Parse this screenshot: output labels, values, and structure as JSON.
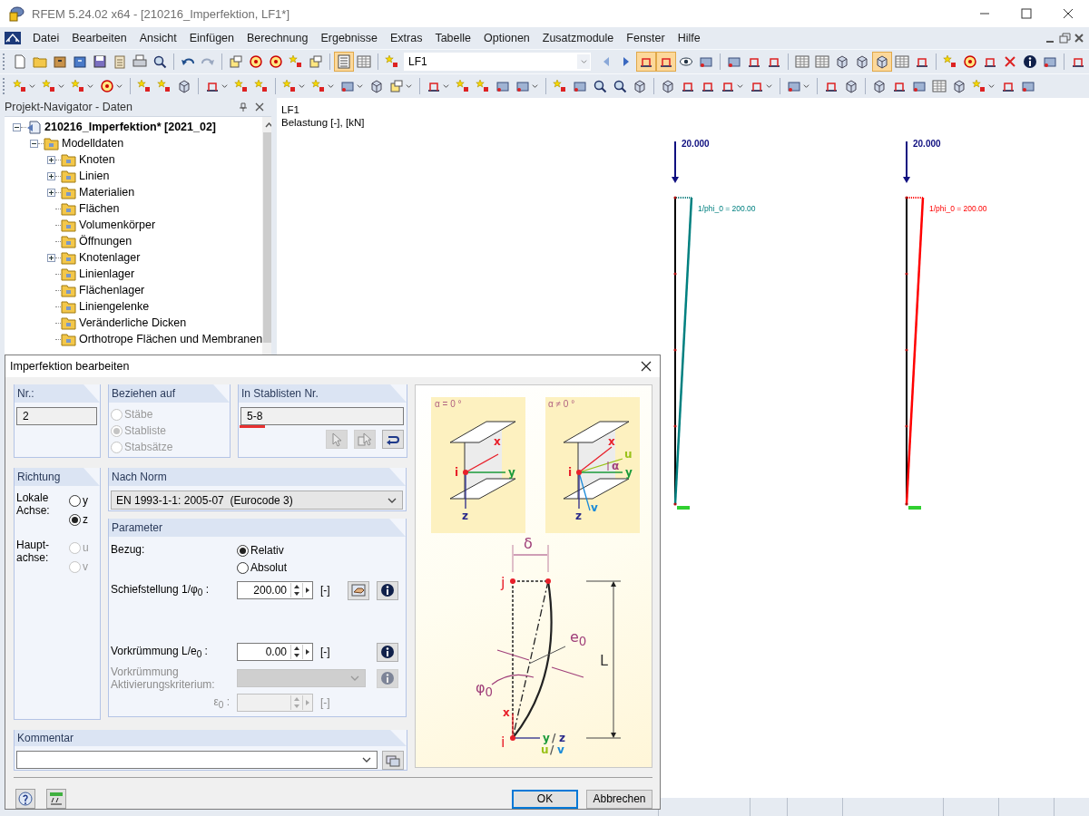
{
  "window": {
    "title": "RFEM 5.24.02 x64 - [210216_Imperfektion, LF1*]"
  },
  "menu": [
    "Datei",
    "Bearbeiten",
    "Ansicht",
    "Einfügen",
    "Berechnung",
    "Ergebnisse",
    "Extras",
    "Tabelle",
    "Optionen",
    "Zusatzmodule",
    "Fenster",
    "Hilfe"
  ],
  "toolbars": [
    {
      "items": [
        {
          "kind": "button",
          "on": false
        },
        {
          "kind": "button",
          "on": false
        },
        {
          "kind": "button",
          "on": false
        },
        {
          "kind": "button",
          "on": false
        },
        {
          "kind": "button",
          "on": false
        },
        {
          "kind": "button",
          "on": false
        },
        {
          "kind": "button",
          "on": false
        },
        {
          "kind": "button",
          "on": false
        },
        {
          "kind": "separator"
        },
        {
          "kind": "button",
          "on": false
        },
        {
          "kind": "button",
          "on": false
        },
        {
          "kind": "separator"
        },
        {
          "kind": "button",
          "on": false
        },
        {
          "kind": "button",
          "on": false
        },
        {
          "kind": "button",
          "on": false
        },
        {
          "kind": "button",
          "on": false
        },
        {
          "kind": "button",
          "on": false
        },
        {
          "kind": "separator"
        },
        {
          "kind": "button",
          "on": true
        },
        {
          "kind": "button",
          "on": false
        },
        {
          "kind": "separator"
        },
        {
          "kind": "button",
          "on": false
        },
        {
          "kind": "combo",
          "value": "LF1"
        },
        {
          "kind": "button",
          "on": false
        },
        {
          "kind": "button",
          "on": false
        },
        {
          "kind": "button",
          "on": true
        },
        {
          "kind": "button",
          "on": true
        },
        {
          "kind": "button",
          "on": false
        },
        {
          "kind": "button",
          "on": false
        },
        {
          "kind": "separator"
        },
        {
          "kind": "button",
          "on": false
        },
        {
          "kind": "button",
          "on": false
        },
        {
          "kind": "button",
          "on": false
        },
        {
          "kind": "separator"
        },
        {
          "kind": "button",
          "on": false
        },
        {
          "kind": "button",
          "on": false
        },
        {
          "kind": "button",
          "on": false
        },
        {
          "kind": "button",
          "on": false
        },
        {
          "kind": "button",
          "on": true
        },
        {
          "kind": "button",
          "on": false
        },
        {
          "kind": "button",
          "on": false
        },
        {
          "kind": "separator"
        },
        {
          "kind": "button",
          "on": false
        },
        {
          "kind": "button",
          "on": false
        },
        {
          "kind": "button",
          "on": false
        },
        {
          "kind": "button",
          "on": false
        },
        {
          "kind": "button",
          "on": false
        },
        {
          "kind": "button",
          "on": false
        },
        {
          "kind": "separator"
        },
        {
          "kind": "button",
          "on": false
        }
      ]
    },
    {
      "items": [
        {
          "kind": "split",
          "on": false
        },
        {
          "kind": "split",
          "on": false
        },
        {
          "kind": "split",
          "on": false
        },
        {
          "kind": "split",
          "on": false
        },
        {
          "kind": "separator"
        },
        {
          "kind": "button",
          "on": false
        },
        {
          "kind": "button",
          "on": false
        },
        {
          "kind": "button",
          "on": false
        },
        {
          "kind": "separator"
        },
        {
          "kind": "split",
          "on": false
        },
        {
          "kind": "button",
          "on": false
        },
        {
          "kind": "button",
          "on": false
        },
        {
          "kind": "separator"
        },
        {
          "kind": "split",
          "on": false
        },
        {
          "kind": "split",
          "on": false
        },
        {
          "kind": "split",
          "on": false
        },
        {
          "kind": "button",
          "on": false
        },
        {
          "kind": "split",
          "on": false
        },
        {
          "kind": "separator"
        },
        {
          "kind": "split",
          "on": false
        },
        {
          "kind": "button",
          "on": false
        },
        {
          "kind": "button",
          "on": false
        },
        {
          "kind": "button",
          "on": false
        },
        {
          "kind": "split",
          "on": false
        },
        {
          "kind": "separator"
        },
        {
          "kind": "button",
          "on": false
        },
        {
          "kind": "button",
          "on": false
        },
        {
          "kind": "button",
          "on": false
        },
        {
          "kind": "button",
          "on": false
        },
        {
          "kind": "button",
          "on": false
        },
        {
          "kind": "separator"
        },
        {
          "kind": "button",
          "on": false
        },
        {
          "kind": "button",
          "on": false
        },
        {
          "kind": "button",
          "on": false
        },
        {
          "kind": "split",
          "on": false
        },
        {
          "kind": "split",
          "on": false
        },
        {
          "kind": "separator"
        },
        {
          "kind": "split",
          "on": false
        },
        {
          "kind": "separator"
        },
        {
          "kind": "button",
          "on": false
        },
        {
          "kind": "button",
          "on": false
        },
        {
          "kind": "separator"
        },
        {
          "kind": "button",
          "on": false
        },
        {
          "kind": "button",
          "on": false
        },
        {
          "kind": "button",
          "on": false
        },
        {
          "kind": "button",
          "on": false
        },
        {
          "kind": "button",
          "on": false
        },
        {
          "kind": "split",
          "on": false
        },
        {
          "kind": "button",
          "on": false
        },
        {
          "kind": "button",
          "on": false
        }
      ]
    }
  ],
  "navigator": {
    "title": "Projekt-Navigator - Daten",
    "tree": [
      {
        "label": "210216_Imperfektion* [2021_02]",
        "expandable": true,
        "expanded": true,
        "children": [
          {
            "label": "Modelldaten",
            "expandable": true,
            "expanded": true,
            "children": [
              {
                "label": "Knoten",
                "expandable": true,
                "expanded": false
              },
              {
                "label": "Linien",
                "expandable": true,
                "expanded": false
              },
              {
                "label": "Materialien",
                "expandable": true,
                "expanded": false
              },
              {
                "label": "Flächen",
                "expandable": false,
                "expanded": false
              },
              {
                "label": "Volumenkörper",
                "expandable": false,
                "expanded": false
              },
              {
                "label": "Öffnungen",
                "expandable": false,
                "expanded": false
              },
              {
                "label": "Knotenlager",
                "expandable": true,
                "expanded": false
              },
              {
                "label": "Linienlager",
                "expandable": false,
                "expanded": false
              },
              {
                "label": "Flächenlager",
                "expandable": false,
                "expanded": false
              },
              {
                "label": "Liniengelenke",
                "expandable": false,
                "expanded": false
              },
              {
                "label": "Veränderliche Dicken",
                "expandable": false,
                "expanded": false
              },
              {
                "label": "Orthotrope Flächen und Membranen",
                "expandable": false,
                "expanded": false
              }
            ]
          }
        ]
      }
    ]
  },
  "canvas": {
    "title": "LF1",
    "subtitle": "Belastung [-], [kN]",
    "members": [
      {
        "load": "20.000",
        "label": "1/phi_0 = 200.00",
        "color": "#008080"
      },
      {
        "load": "20.000",
        "label": "1/phi_0 = 200.00",
        "color": "#ff0000"
      }
    ]
  },
  "dialog": {
    "title": "Imperfektion bearbeiten",
    "nr": {
      "label": "Nr.:",
      "value": "2"
    },
    "beziehen_auf": {
      "label": "Beziehen auf",
      "options": [
        {
          "label": "Stäbe",
          "selected": false,
          "disabled": true
        },
        {
          "label": "Stabliste",
          "selected": true,
          "disabled": true
        },
        {
          "label": "Stabsätze",
          "selected": false,
          "disabled": true
        }
      ]
    },
    "stablisten": {
      "label": "In Stablisten Nr.",
      "value": "5-8",
      "flagged": true,
      "buttons": [
        {
          "disabled": true
        },
        {
          "disabled": true
        },
        {
          "disabled": false
        }
      ]
    },
    "richtung": {
      "label": "Richtung",
      "groups": [
        {
          "label": "Lokale Achse:",
          "options": [
            {
              "label": "y",
              "selected": false,
              "disabled": false
            },
            {
              "label": "z",
              "selected": true,
              "disabled": false
            }
          ]
        },
        {
          "label": "Haupt-achse:",
          "options": [
            {
              "label": "u",
              "selected": false,
              "disabled": true
            },
            {
              "label": "v",
              "selected": false,
              "disabled": true
            }
          ]
        }
      ]
    },
    "norm": {
      "label": "Nach Norm",
      "value": "EN 1993-1-1: 2005-07  (Eurocode 3)"
    },
    "parameter": {
      "label": "Parameter",
      "bezug": {
        "label": "Bezug:",
        "options": [
          {
            "label": "Relativ",
            "selected": true,
            "disabled": false
          },
          {
            "label": "Absolut",
            "selected": false,
            "disabled": false
          }
        ]
      },
      "rows": [
        {
          "kind": "spinner",
          "label": "Schiefstellung 1/φ$_{0}$ :",
          "value": "200.00",
          "unit": "[-]",
          "disabled": false,
          "buttons": [
            {
              "kind": "edit",
              "disabled": false
            },
            {
              "kind": "info",
              "disabled": false
            }
          ]
        },
        {
          "kind": "spinner",
          "label": "Vorkrümmung L/e$_{0}$ :",
          "value": "0.00",
          "unit": "[-]",
          "disabled": false,
          "buttons": [
            {
              "kind": "info",
              "disabled": false
            }
          ]
        },
        {
          "kind": "dropdown",
          "label": "Vorkrümmung Aktivierungskriterium:",
          "disabled": true,
          "buttons": [
            {
              "kind": "info",
              "disabled": true
            }
          ]
        },
        {
          "kind": "spinner",
          "label": "ε$_{0}$ :",
          "unit": "[-]",
          "disabled": true
        }
      ]
    },
    "kommentar": {
      "label": "Kommentar"
    },
    "figure": {
      "captions": [
        "α = 0 °",
        "α ≠ 0 °"
      ],
      "labels": [
        {
          "text": "x",
          "color": "#e8202a"
        },
        {
          "text": "i",
          "color": "#e8202a"
        },
        {
          "text": "y",
          "color": "#1a9a3a"
        },
        {
          "text": "z",
          "color": "#2a2a8a"
        },
        {
          "text": "x",
          "color": "#e8202a"
        },
        {
          "text": "u",
          "color": "#9ac21a"
        },
        {
          "text": "α",
          "color": "#a0407a"
        },
        {
          "text": "i",
          "color": "#e8202a"
        },
        {
          "text": "y",
          "color": "#1a9a3a"
        },
        {
          "text": "z",
          "color": "#2a2a8a"
        },
        {
          "text": "v",
          "color": "#1a8ad8"
        },
        {
          "text": "δ",
          "color": "#a0407a"
        },
        {
          "text": "j",
          "color": "#e8202a"
        },
        {
          "text": "e$_{0}$",
          "color": "#a0407a"
        },
        {
          "text": "L",
          "color": "#333333"
        },
        {
          "text": "φ$_{0}$",
          "color": "#a0407a"
        },
        {
          "text": "x",
          "color": "#e8202a"
        },
        {
          "text": "i",
          "color": "#e8202a"
        },
        {
          "text": "y",
          "color": "#1a9a3a"
        },
        {
          "text": "/",
          "color": "#555555"
        },
        {
          "text": "z",
          "color": "#2a2a8a"
        },
        {
          "text": "u",
          "color": "#9ac21a"
        },
        {
          "text": "/",
          "color": "#555555"
        },
        {
          "text": "v",
          "color": "#1a8ad8"
        }
      ]
    },
    "buttons": [
      {
        "label": "OK",
        "default": true
      },
      {
        "label": "Abbrechen",
        "default": false
      }
    ]
  }
}
